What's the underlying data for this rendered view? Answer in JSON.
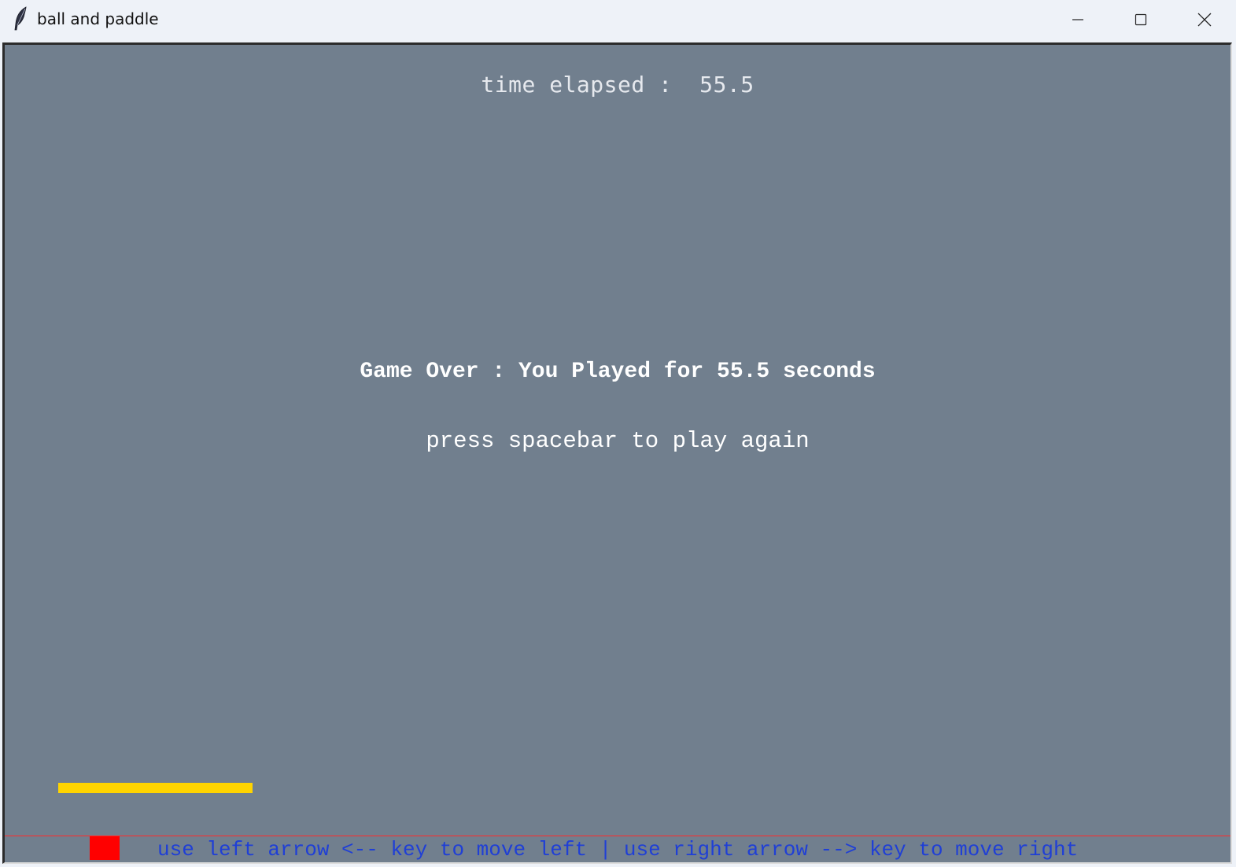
{
  "window": {
    "title": "ball and paddle",
    "app_icon": "feather-icon",
    "controls": {
      "minimize_icon": "minimize-icon",
      "maximize_icon": "maximize-icon",
      "close_icon": "close-icon"
    }
  },
  "game": {
    "time_label": "time elapsed :  55.5",
    "game_over_message": "Game Over : You Played for 55.5 seconds",
    "restart_prompt": "press spacebar to play again",
    "instructions": "use left arrow <-- key to move left | use right arrow --> key to move right",
    "colors": {
      "background": "#717f8e",
      "paddle": "#ffd400",
      "ball": "#ff0000",
      "floor_line": "#ff2a2a",
      "instructions_text": "#1f3fd6",
      "message_text": "#ffffff"
    }
  }
}
